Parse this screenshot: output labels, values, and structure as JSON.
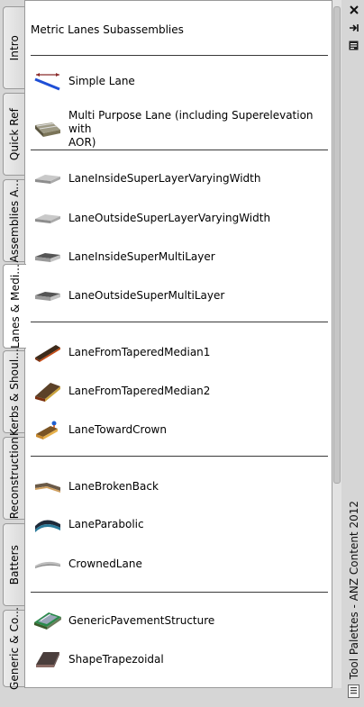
{
  "window": {
    "title": "Tool Palettes - ANZ Content 2012"
  },
  "tabs": [
    {
      "label": "Intro",
      "active": false
    },
    {
      "label": "Quick Ref",
      "active": false
    },
    {
      "label": "Assemblies A...",
      "active": false
    },
    {
      "label": "Lanes & Medi...",
      "active": true
    },
    {
      "label": "Kerbs & Shoul...",
      "active": false
    },
    {
      "label": "Reconstruction",
      "active": false
    },
    {
      "label": "Batters",
      "active": false
    },
    {
      "label": "Generic & Co...",
      "active": false
    }
  ],
  "palette": {
    "header": "Metric Lanes Subassemblies",
    "items": [
      {
        "label": "Simple Lane",
        "icon": "simple-lane-icon"
      },
      {
        "label": "Multi Purpose Lane (including Superelevation with",
        "label2": "AOR)",
        "icon": "multi-purpose-lane-icon"
      },
      {
        "label": "LaneInsideSuperLayerVaryingWidth",
        "icon": "layer-slab-icon"
      },
      {
        "label": "LaneOutsideSuperLayerVaryingWidth",
        "icon": "layer-slab-icon"
      },
      {
        "label": "LaneInsideSuperMultiLayer",
        "icon": "multilayer-slab-icon"
      },
      {
        "label": "LaneOutsideSuperMultiLayer",
        "icon": "multilayer-slab-icon"
      },
      {
        "label": "LaneFromTaperedMedian1",
        "icon": "tapered-median-icon"
      },
      {
        "label": "LaneFromTaperedMedian2",
        "icon": "tapered-median-icon"
      },
      {
        "label": "LaneTowardCrown",
        "icon": "lane-toward-crown-icon"
      },
      {
        "label": "LaneBrokenBack",
        "icon": "broken-back-icon"
      },
      {
        "label": "LaneParabolic",
        "icon": "parabolic-icon"
      },
      {
        "label": "CrownedLane",
        "icon": "crowned-lane-icon"
      },
      {
        "label": "GenericPavementStructure",
        "icon": "pavement-structure-icon"
      },
      {
        "label": "ShapeTrapezoidal",
        "icon": "trapezoid-shape-icon"
      }
    ]
  },
  "titlebar_buttons": [
    {
      "icon": "close-icon",
      "glyph": "×"
    },
    {
      "icon": "auto-hide-icon",
      "glyph": "⇥"
    },
    {
      "icon": "properties-icon",
      "glyph": "▤"
    }
  ]
}
